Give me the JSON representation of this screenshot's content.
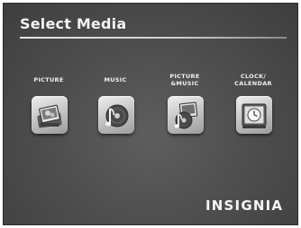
{
  "screen": {
    "title": "Select Media",
    "brand": "INSIGNIA"
  },
  "media_items": [
    {
      "label": "PICTURE",
      "icon": "picture-icon"
    },
    {
      "label": "MUSIC",
      "icon": "music-icon"
    },
    {
      "label": "PICTURE\n&MUSIC",
      "icon": "picture-music-icon"
    },
    {
      "label": "CLOCK/\nCALENDAR",
      "icon": "clock-calendar-icon"
    }
  ]
}
